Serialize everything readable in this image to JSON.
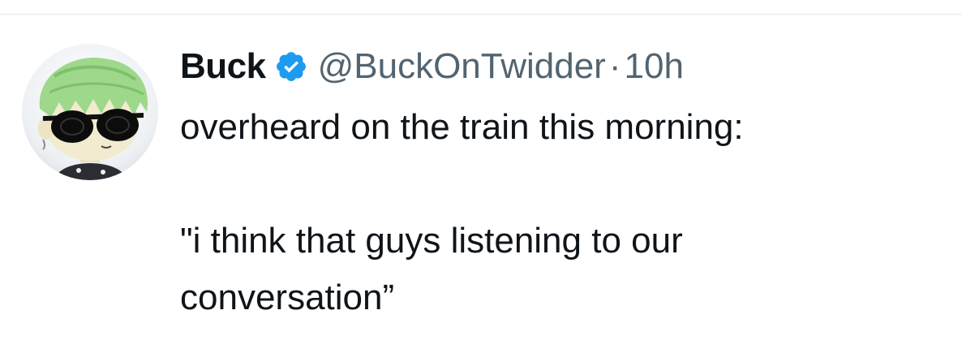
{
  "tweet": {
    "author": {
      "display_name": "Buck",
      "verified": true,
      "handle": "@BuckOnTwidder",
      "avatar_icon": "avatar-cartoon-green-hair-sunglasses"
    },
    "separator": "·",
    "timestamp": "10h",
    "text_lines": [
      "overheard on the train this morning:",
      "",
      "\"i think that guys listening to our",
      "conversation”"
    ]
  },
  "colors": {
    "text_primary": "#0f1419",
    "text_secondary": "#536471",
    "verified_blue": "#1d9bf0",
    "divider": "#e6e9eb"
  }
}
